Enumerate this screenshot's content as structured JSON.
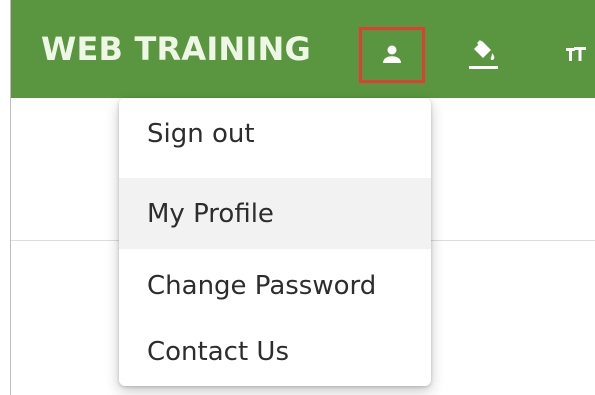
{
  "header": {
    "brand": "WEB TRAINING",
    "icons": {
      "user": "user-icon",
      "paint": "paint-bucket-icon",
      "text_size": "text-size-icon"
    }
  },
  "dropdown": {
    "items": [
      {
        "label": "Sign out"
      },
      {
        "label": "My Profile"
      },
      {
        "label": "Change Password"
      },
      {
        "label": "Contact Us"
      }
    ]
  },
  "colors": {
    "header": "#5a963f",
    "brand_text": "#eef7e6",
    "highlight_border": "#e23d35",
    "menu_hover": "#f2f2f2"
  }
}
